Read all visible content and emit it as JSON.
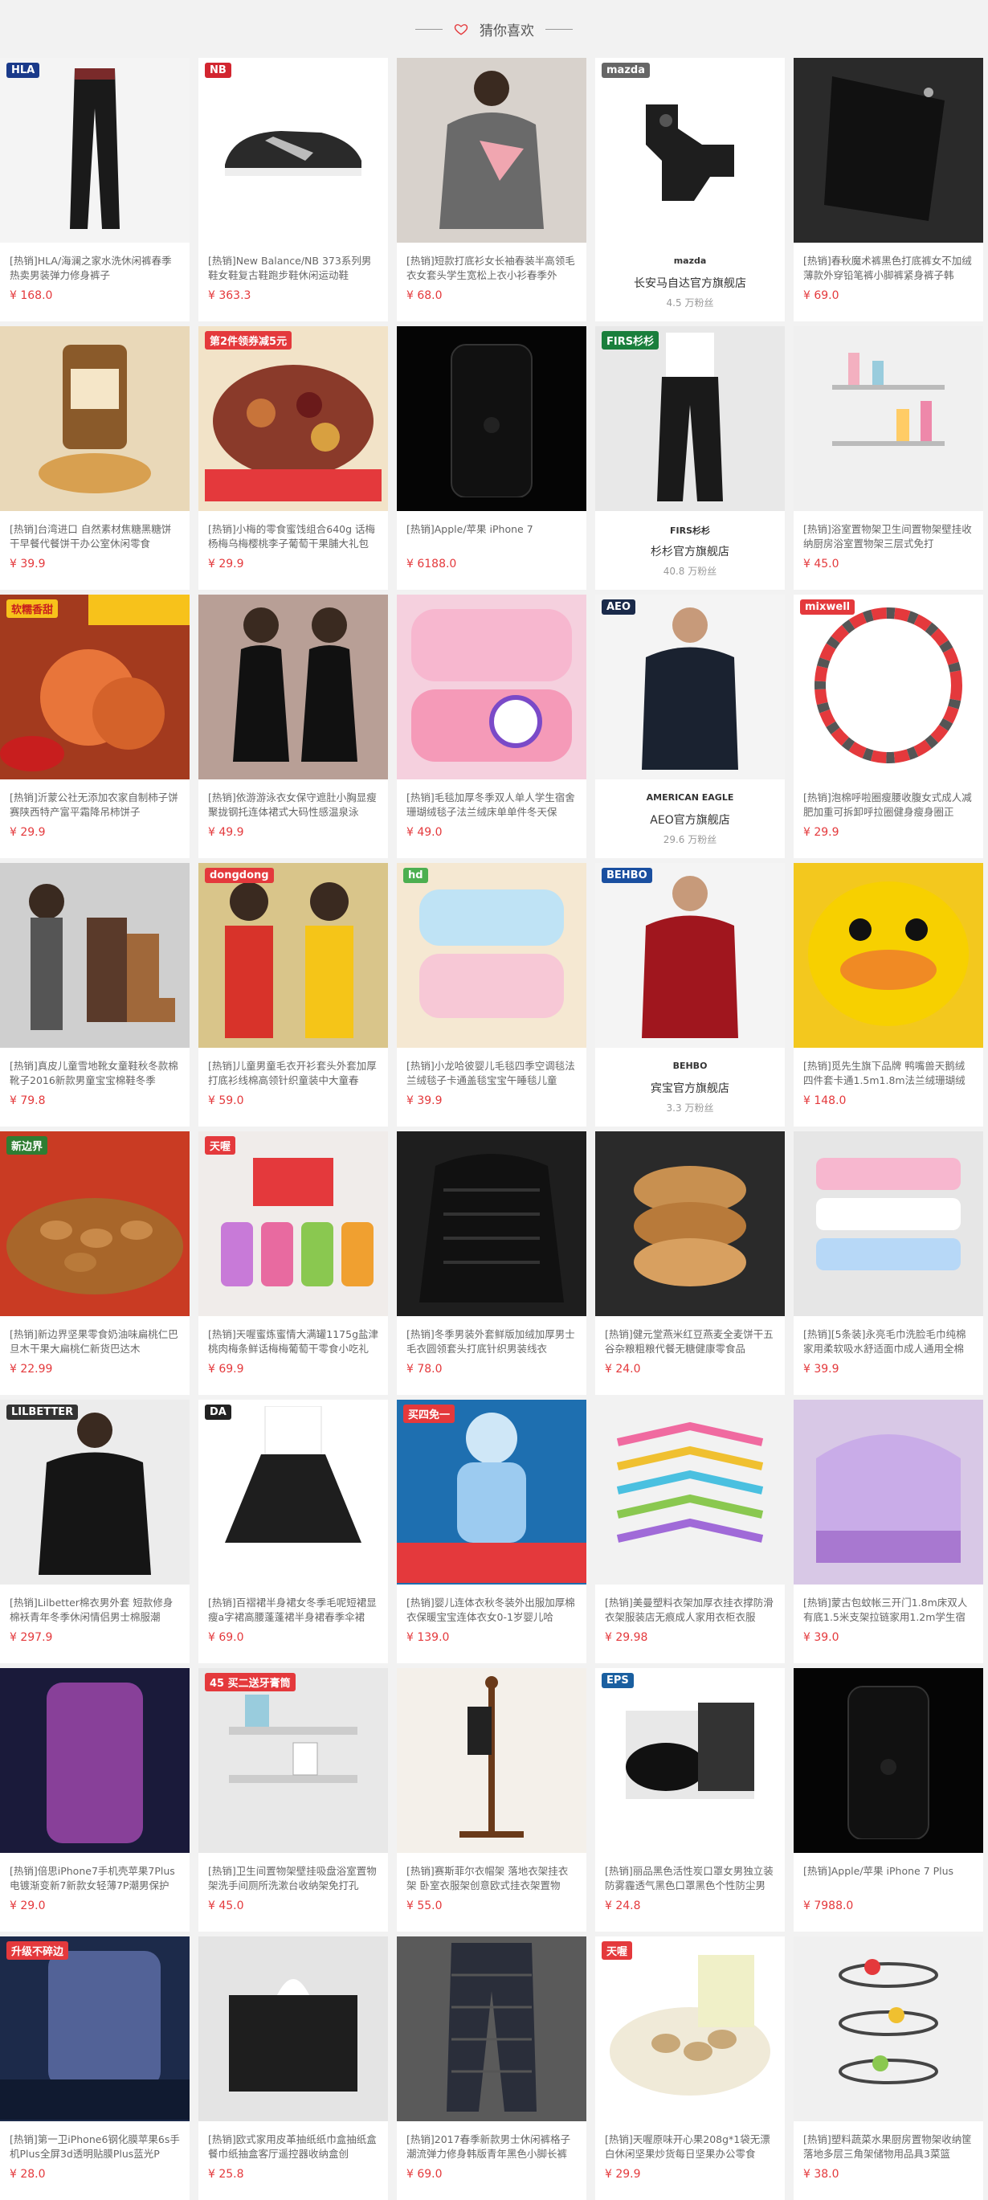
{
  "header": {
    "title": "猜你喜欢"
  },
  "products": [
    {
      "type": "product",
      "name": "[热销]HLA/海澜之家水洗休闲裤春季热卖男装弹力修身裤子",
      "price": "¥ 168.0",
      "bg": "#f4f4f4",
      "shape": "pants-dark",
      "tag": "HLA",
      "tagColor": "#1a3a8a"
    },
    {
      "type": "product",
      "name": "[热销]New Balance/NB 373系列男鞋女鞋复古鞋跑步鞋休闲运动鞋",
      "price": "¥ 363.3",
      "bg": "#ffffff",
      "shape": "shoe",
      "tag": "NB",
      "tagColor": "#d22630"
    },
    {
      "type": "product",
      "name": "[热销]短款打底衫女长袖春装半高领毛衣女套头学生宽松上衣小衫春季外",
      "price": "¥ 68.0",
      "bg": "#d8d2cc",
      "shape": "sweater",
      "tag": "",
      "tagColor": ""
    },
    {
      "type": "shop",
      "shopname": "长安马自达官方旗舰店",
      "fans": "4.5 万粉丝",
      "logo": "mazda",
      "bg": "#ffffff",
      "shape": "car-part",
      "tag": "mazda",
      "tagColor": "#666"
    },
    {
      "type": "product",
      "name": "[热销]春秋魔术裤黑色打底裤女不加绒薄款外穿铅笔裤小脚裤紧身裤子韩",
      "price": "¥ 69.0",
      "bg": "#2a2a2a",
      "shape": "fabric",
      "tag": "",
      "tagColor": ""
    },
    {
      "type": "product",
      "name": "[热销]台湾进口 自然素材焦糖黑糖饼干早餐代餐饼干办公室休闲零食",
      "price": "¥ 39.9",
      "bg": "#e9d8b8",
      "shape": "jar",
      "tag": "",
      "tagColor": ""
    },
    {
      "type": "product",
      "name": "[热销]小梅的零食蜜饯组合640g 话梅杨梅乌梅樱桃李子葡萄干果脯大礼包",
      "price": "¥ 29.9",
      "bg": "#f2e3c8",
      "shape": "snacks",
      "tag": "第2件领券减5元",
      "tagColor": "#e4393c"
    },
    {
      "type": "product",
      "name": "[热销]Apple/苹果 iPhone 7",
      "price": "¥ 6188.0",
      "bg": "#050505",
      "shape": "phone",
      "tag": "",
      "tagColor": ""
    },
    {
      "type": "shop",
      "shopname": "杉杉官方旗舰店",
      "fans": "40.8 万粉丝",
      "logo": "FIRS杉杉",
      "bg": "#e8e8e8",
      "shape": "trousers",
      "tag": "FIRS杉杉",
      "tagColor": "#1a7f3c"
    },
    {
      "type": "product",
      "name": "[热销]浴室置物架卫生间置物架壁挂收纳厨房浴室置物架三层式免打",
      "price": "¥ 45.0",
      "bg": "#f0f0f0",
      "shape": "shelf",
      "tag": "",
      "tagColor": ""
    },
    {
      "type": "product",
      "name": "[热销]沂蒙公社无添加农家自制柿子饼赛陕西特产富平霜降吊柿饼子",
      "price": "¥ 29.9",
      "bg": "#a33a1e",
      "shape": "persimmon",
      "tag": "软糯香甜",
      "tagColor": "#f7c21b"
    },
    {
      "type": "product",
      "name": "[热销]依游游泳衣女保守遮肚小胸显瘦聚拢钢托连体裙式大码性感温泉泳",
      "price": "¥ 49.9",
      "bg": "#b89f96",
      "shape": "swimsuit",
      "tag": "",
      "tagColor": ""
    },
    {
      "type": "product",
      "name": "[热销]毛毯加厚冬季双人单人学生宿舍珊瑚绒毯子法兰绒床单单件冬天保",
      "price": "¥ 49.0",
      "bg": "#f5d0de",
      "shape": "blanket",
      "tag": "",
      "tagColor": ""
    },
    {
      "type": "shop",
      "shopname": "AEO官方旗舰店",
      "fans": "29.6 万粉丝",
      "logo": "AMERICAN EAGLE",
      "bg": "#f4f4f4",
      "shape": "man-sweater",
      "tag": "AEO",
      "tagColor": "#1a2a4a"
    },
    {
      "type": "product",
      "name": "[热销]泡棉呼啦圈瘦腰收腹女式成人减肥加重可拆卸呼拉圈健身瘦身圈正",
      "price": "¥ 29.9",
      "bg": "#ffffff",
      "shape": "hoop",
      "tag": "mixwell",
      "tagColor": "#e4393c"
    },
    {
      "type": "product",
      "name": "[热销]真皮儿童雪地靴女童鞋秋冬款棉靴子2016新款男童宝宝棉鞋冬季",
      "price": "¥ 79.8",
      "bg": "#cfcfcf",
      "shape": "boots",
      "tag": "",
      "tagColor": ""
    },
    {
      "type": "product",
      "name": "[热销]儿童男童毛衣开衫套头外套加厚打底衫线棉高领针织童装中大童春",
      "price": "¥ 59.0",
      "bg": "#d9c58a",
      "shape": "kids",
      "tag": "dongdong",
      "tagColor": "#e4393c"
    },
    {
      "type": "product",
      "name": "[热销]小龙哈彼婴儿毛毯四季空调毯法兰绒毯子卡通盖毯宝宝午睡毯儿童",
      "price": "¥ 39.9",
      "bg": "#f5e8d2",
      "shape": "blanket2",
      "tag": "hd",
      "tagColor": "#4caf50"
    },
    {
      "type": "shop",
      "shopname": "宾宝官方旗舰店",
      "fans": "3.3 万粉丝",
      "logo": "BEHBO",
      "bg": "#f4f4f4",
      "shape": "red-sweater",
      "tag": "BEHBO",
      "tagColor": "#1a4fa0"
    },
    {
      "type": "product",
      "name": "[热销]觅先生旗下品牌 鸭嘴兽天鹅绒四件套卡通1.5m1.8m法兰绒珊瑚绒",
      "price": "¥ 148.0",
      "bg": "#f3c81e",
      "shape": "duck",
      "tag": "",
      "tagColor": ""
    },
    {
      "type": "product",
      "name": "[热销]新边界坚果零食奶油味扁桃仁巴旦木干果大扁桃仁新货巴达木",
      "price": "¥ 22.99",
      "bg": "#c93b23",
      "shape": "almonds",
      "tag": "新边界",
      "tagColor": "#2e7d32"
    },
    {
      "type": "product",
      "name": "[热销]天喔蜜炼蜜情大满罐1175g盐津桃肉梅条鲜话梅梅葡萄干零食小吃礼",
      "price": "¥ 69.9",
      "bg": "#f0ecea",
      "shape": "cans",
      "tag": "天喔",
      "tagColor": "#e4393c"
    },
    {
      "type": "product",
      "name": "[热销]冬季男装外套鲜版加绒加厚男士毛衣圆领套头打底针织男装线衣",
      "price": "¥ 78.0",
      "bg": "#1e1e1e",
      "shape": "knit",
      "tag": "",
      "tagColor": ""
    },
    {
      "type": "product",
      "name": "[热销]健元堂燕米红豆燕麦全麦饼干五谷杂粮粗粮代餐无糖健康零食品",
      "price": "¥ 24.0",
      "bg": "#2a2a2a",
      "shape": "cookies",
      "tag": "",
      "tagColor": ""
    },
    {
      "type": "product",
      "name": "[热销][5条装]永亮毛巾洗脸毛巾纯棉家用柔软吸水舒适面巾成人通用全棉",
      "price": "¥ 39.9",
      "bg": "#e6e6e6",
      "shape": "towels",
      "tag": "",
      "tagColor": ""
    },
    {
      "type": "product",
      "name": "[热销]Lilbetter棉衣男外套 短款修身棉袄青年冬季休闲情侣男士棉服潮",
      "price": "¥ 297.9",
      "bg": "#ececec",
      "shape": "jacket",
      "tag": "LILBETTER",
      "tagColor": "#333"
    },
    {
      "type": "product",
      "name": "[热销]百褶裙半身裙女冬季毛呢短裙显瘦a字裙高腰蓬蓬裙半身裙春季伞裙",
      "price": "¥ 69.0",
      "bg": "#ffffff",
      "shape": "skirt",
      "tag": "DA",
      "tagColor": "#222"
    },
    {
      "type": "product",
      "name": "[热销]婴儿连体衣秋冬装外出服加厚棉衣保暖宝宝连体衣女0-1岁婴儿哈",
      "price": "¥ 139.0",
      "bg": "#1e6fb0",
      "shape": "baby",
      "tag": "买四免一",
      "tagColor": "#e4393c"
    },
    {
      "type": "product",
      "name": "[热销]美曼塑料衣架加厚衣挂衣撑防滑衣架服装店无痕成人家用衣柜衣服",
      "price": "¥ 29.98",
      "bg": "#f2f2f2",
      "shape": "hangers",
      "tag": "",
      "tagColor": ""
    },
    {
      "type": "product",
      "name": "[热销]蒙古包蚊帐三开门1.8m床双人有底1.5米支架拉链家用1.2m学生宿",
      "price": "¥ 39.0",
      "bg": "#d8c8e6",
      "shape": "net",
      "tag": "",
      "tagColor": ""
    },
    {
      "type": "product",
      "name": "[热销]倍思iPhone7手机壳苹果7Plus电镀渐变新7新款女轻薄7P潮男保护",
      "price": "¥ 29.0",
      "bg": "#1a1a3a",
      "shape": "case",
      "tag": "",
      "tagColor": ""
    },
    {
      "type": "product",
      "name": "[热销]卫生间置物架壁挂吸盘浴室置物架洗手间厕所洗漱台收纳架免打孔",
      "price": "¥ 45.0",
      "bg": "#e8e8e8",
      "shape": "shelf2",
      "tag": "45 买二送牙膏筒",
      "tagColor": "#e4393c"
    },
    {
      "type": "product",
      "name": "[热销]赛斯菲尔衣帽架 落地衣架挂衣架 卧室衣服架创意欧式挂衣架置物",
      "price": "¥ 55.0",
      "bg": "#f4f0ea",
      "shape": "rack",
      "tag": "",
      "tagColor": ""
    },
    {
      "type": "product",
      "name": "[热销]丽品黑色活性炭口罩女男独立装防雾霾透气黑色口罩黑色个性防尘男50",
      "price": "¥ 24.8",
      "bg": "#ffffff",
      "shape": "masks",
      "tag": "EPS",
      "tagColor": "#1a5fa0"
    },
    {
      "type": "product",
      "name": "[热销]Apple/苹果 iPhone 7 Plus",
      "price": "¥ 7988.0",
      "bg": "#050505",
      "shape": "phone",
      "tag": "",
      "tagColor": ""
    },
    {
      "type": "product",
      "name": "[热销]第一卫iPhone6钢化膜苹果6s手机Plus全屏3d透明贴膜Plus蓝光P",
      "price": "¥ 28.0",
      "bg": "#1c2a4a",
      "shape": "film",
      "tag": "升级不碎边",
      "tagColor": "#e4393c"
    },
    {
      "type": "product",
      "name": "[热销]欧式家用皮革抽纸纸巾盒抽纸盒 餐巾纸抽盒客厅遥控器收纳盒创",
      "price": "¥ 25.8",
      "bg": "#e4e4e4",
      "shape": "box",
      "tag": "",
      "tagColor": ""
    },
    {
      "type": "product",
      "name": "[热销]2017春季新款男士休闲裤格子潮流弹力修身韩版青年黑色小脚长裤",
      "price": "¥ 69.0",
      "bg": "#5a5a5a",
      "shape": "plaid",
      "tag": "",
      "tagColor": ""
    },
    {
      "type": "product",
      "name": "[热销]天喔原味开心果208g*1袋无漂白休闲坚果炒货每日坚果办公零食",
      "price": "¥ 29.9",
      "bg": "#ffffff",
      "shape": "pistachio",
      "tag": "天喔",
      "tagColor": "#e4393c"
    },
    {
      "type": "product",
      "name": "[热销]塑料蔬菜水果厨房置物架收纳筐落地多层三角架储物用品具3菜篮",
      "price": "¥ 38.0",
      "bg": "#f0f0f0",
      "shape": "fruit-rack",
      "tag": "",
      "tagColor": ""
    }
  ],
  "colors": {
    "price": "#e4393c",
    "accent": "#e4393c",
    "background": "#f2f2f2"
  }
}
